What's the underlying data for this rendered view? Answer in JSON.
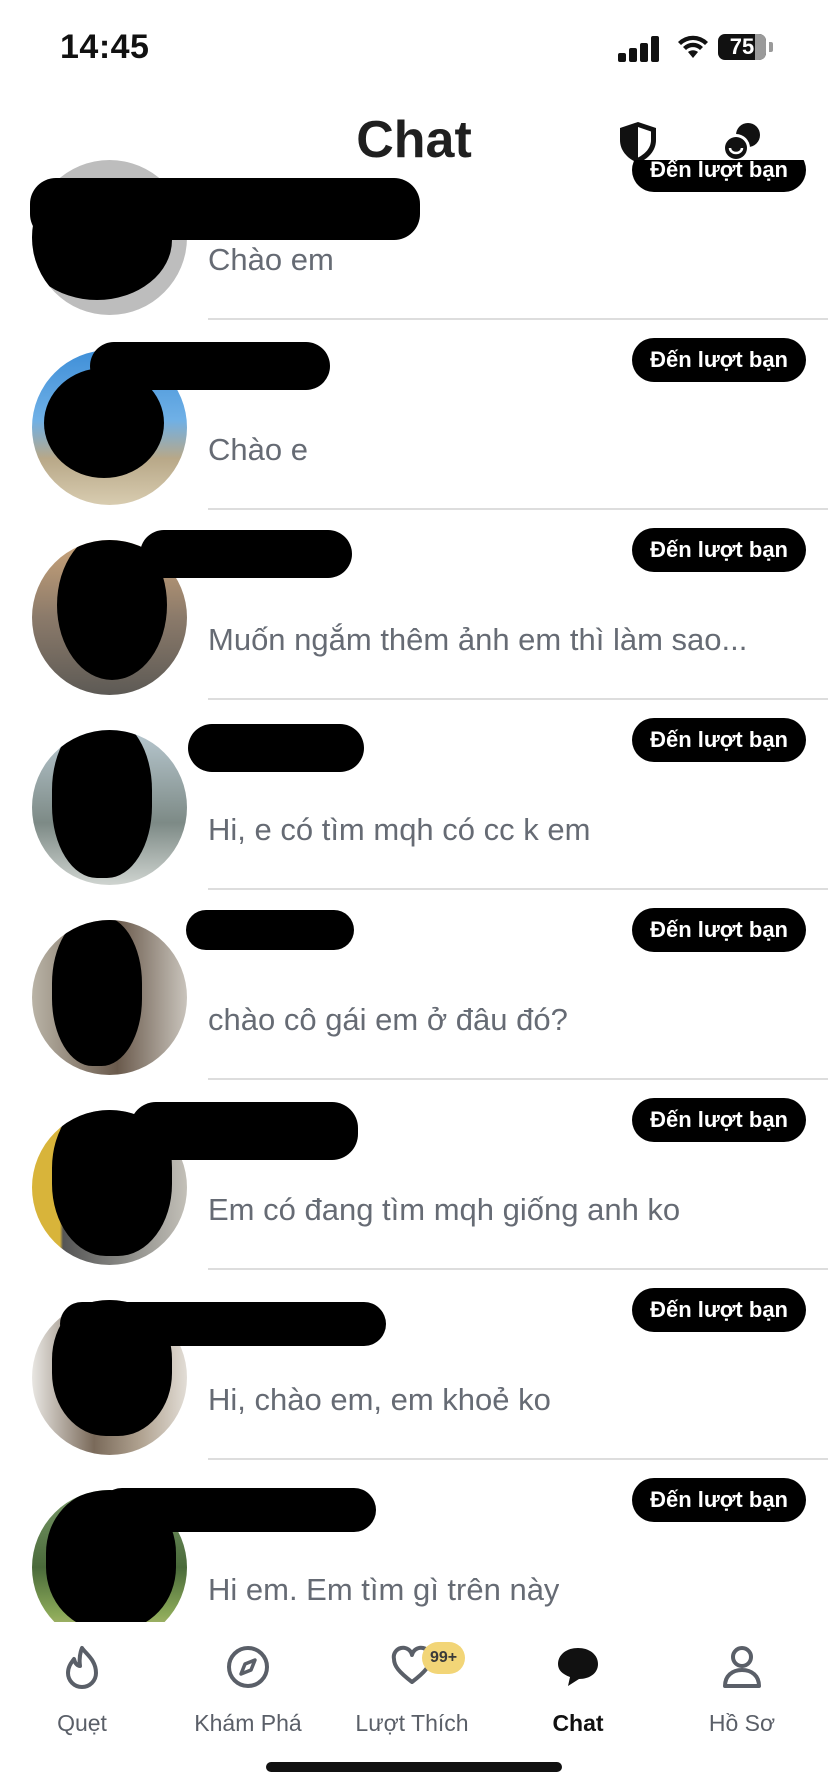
{
  "status": {
    "time": "14:45",
    "battery": "75"
  },
  "header": {
    "title": "Chat"
  },
  "chats": [
    {
      "preview": "Chào em",
      "badge": "Đến lượt bạn"
    },
    {
      "preview": "Chào e",
      "badge": "Đến lượt bạn"
    },
    {
      "preview": "Muốn ngắm thêm ảnh em thì làm sao...",
      "badge": "Đến lượt bạn"
    },
    {
      "preview": "Hi, e có tìm mqh có cc k em",
      "badge": "Đến lượt bạn"
    },
    {
      "preview": "chào cô gái em ở đâu đó?",
      "badge": "Đến lượt bạn"
    },
    {
      "preview": "Em có đang tìm mqh giống anh ko",
      "badge": "Đến lượt bạn"
    },
    {
      "preview": "Hi, chào em, em khoẻ ko",
      "badge": "Đến lượt bạn"
    },
    {
      "preview": "Hi em. Em tìm gì trên này",
      "badge": "Đến lượt bạn"
    }
  ],
  "tabs": [
    {
      "label": "Quẹt",
      "icon": "flame-icon"
    },
    {
      "label": "Khám Phá",
      "icon": "compass-icon"
    },
    {
      "label": "Lượt Thích",
      "icon": "heart-icon",
      "count": "99+"
    },
    {
      "label": "Chat",
      "icon": "chat-bubble-icon",
      "active": true
    },
    {
      "label": "Hồ Sơ",
      "icon": "profile-icon"
    }
  ],
  "colors": {
    "badge_bg": "#000000",
    "like_count_bg": "#f2d577",
    "preview_text": "#666b74"
  }
}
